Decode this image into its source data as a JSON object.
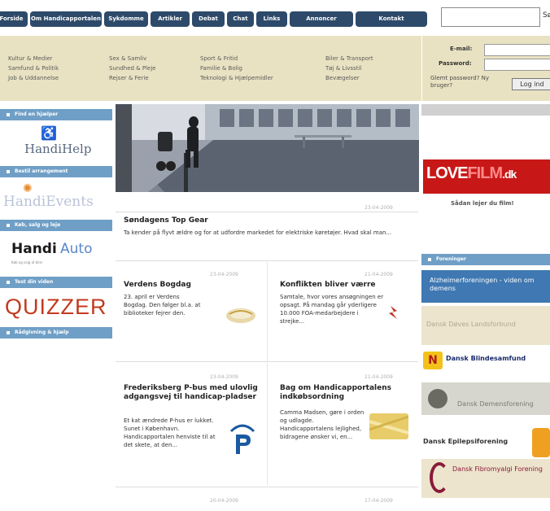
{
  "nav": {
    "items": [
      "Forside",
      "Om Handicapportalen",
      "Sykdomme",
      "Artikler",
      "Debat",
      "Chat",
      "Links",
      "Annoncer",
      "Kontakt"
    ],
    "search_placeholder": "",
    "search_label": "Sø"
  },
  "categories": {
    "columns": [
      [
        "Kultur & Medier",
        "Samfund & Politik",
        "Job & Uddannelse"
      ],
      [
        "Sex & Samliv",
        "Sundhed & Pleje",
        "Rejser & Ferie"
      ],
      [
        "Sport & Fritid",
        "Familie & Bolig",
        "Teknologi & Hjælpemidler"
      ],
      [
        "Biler & Transport",
        "Tøj & Livsstil",
        "Bevægelser"
      ]
    ]
  },
  "login": {
    "email_label": "E-mail:",
    "password_label": "Password:",
    "forgot_text": "Glemt password? Ny bruger?",
    "login_button": "Log ind"
  },
  "sidebar": {
    "bars": [
      "Find en hjælper",
      "Bestil arrangement",
      "Køb, salg og leje",
      "Test din viden",
      "Rådgivning & hjælp"
    ],
    "brands": {
      "handihelp": "HandiHelp",
      "handievents": "HandiEvents",
      "handiauto_bold": "Handi",
      "handiauto_light": "Auto",
      "handiauto_sub": "Køb og salg af biler",
      "quizzer": "QUIZZER"
    }
  },
  "articles": {
    "featured": {
      "date": "23-04-2009",
      "title": "Søndagens Top Gear",
      "text": "Ta kender på flyvt ældre og for at udfordre markedet for elektriske køretøjer. Hvad skal man..."
    },
    "a1": {
      "date": "23-04-2009",
      "title": "Verdens Bogdag",
      "text": "23. april er Verdens Bogdag. Den følger bl.a. at biblioteker fejrer den."
    },
    "a2": {
      "date": "21-04-2009",
      "title": "Konflikten bliver værre",
      "text": "Samtale, hvor vores ansøgningen er opsagt. På mandag går yderligere 10.000 FOA-medarbejdere i strejke..."
    },
    "a3": {
      "date": "23-04-2009",
      "title": "Frederiksberg P-bus med ulovlig adgangsvej til handicap-pladser",
      "text": "Et kat ændrede P-hus er lukket. Sunet i København. Handicapportalen henviste til at det skete, at den..."
    },
    "a4": {
      "date": "21-04-2009",
      "title": "Bag om Handicapportalens indkøbsordning",
      "text": "Camma Madsen, gøre i orden og udlagde. Handicapportalens lejlighed, bidragene ønsker vi, en..."
    },
    "bottom_dates": [
      "20-04-2009",
      "17-04-2009"
    ]
  },
  "right": {
    "lovefilm_a": "LOVE",
    "lovefilm_b": "FILM",
    "lovefilm_c": ".dk",
    "lovefilm_sub": "Sådan lejer du film!",
    "sponsors_bar": "Foreninger",
    "s1": "Alzheimerforeningen - viden om demens",
    "s2": "Dansk Døves Landsforbund",
    "s3": "Dansk Blindesamfund",
    "s4": "Dansk Demensforening",
    "s5": "Dansk Epilepsiforening",
    "s6": "Dansk Fibromyalgi Forening"
  },
  "colors": {
    "nav_button": "#2d4a6a",
    "category_band": "#e9e2c2",
    "sidebar_bar": "#6f9fc6",
    "lovefilm_red": "#c81717"
  }
}
